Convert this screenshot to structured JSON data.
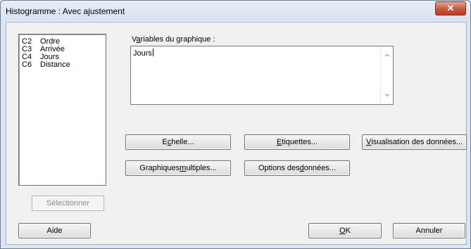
{
  "window": {
    "title": "Histogramme : Avec ajustement",
    "close_glyph": "✕"
  },
  "variables_list": [
    {
      "col": "C2",
      "name": "Ordre"
    },
    {
      "col": "C3",
      "name": "Arrivée"
    },
    {
      "col": "C4",
      "name": "Jours"
    },
    {
      "col": "C6",
      "name": "Distance"
    }
  ],
  "graph_vars": {
    "label_pre": "V",
    "label_mnemonic": "a",
    "label_post": "riables du graphique :",
    "value": "Jours"
  },
  "buttons": {
    "echelle": {
      "pre": "E",
      "mn": "c",
      "post": "helle..."
    },
    "etiquettes": {
      "pre": "",
      "mn": "E",
      "post": "tiquettes..."
    },
    "visualisation": {
      "pre": "",
      "mn": "V",
      "post": "isualisation des données..."
    },
    "graphiques": {
      "pre": "Graphiques ",
      "mn": "m",
      "post": "ultiples..."
    },
    "options": {
      "pre": "Options des ",
      "mn": "d",
      "post": "onnées..."
    },
    "selectionner": "Sélectionner",
    "aide": "Aide",
    "ok": {
      "pre": "",
      "mn": "O",
      "post": "K"
    },
    "annuler": "Annuler"
  },
  "icons": {
    "close": "close-icon",
    "scroll_up": "scroll-up-icon",
    "scroll_down": "scroll-down-icon"
  }
}
